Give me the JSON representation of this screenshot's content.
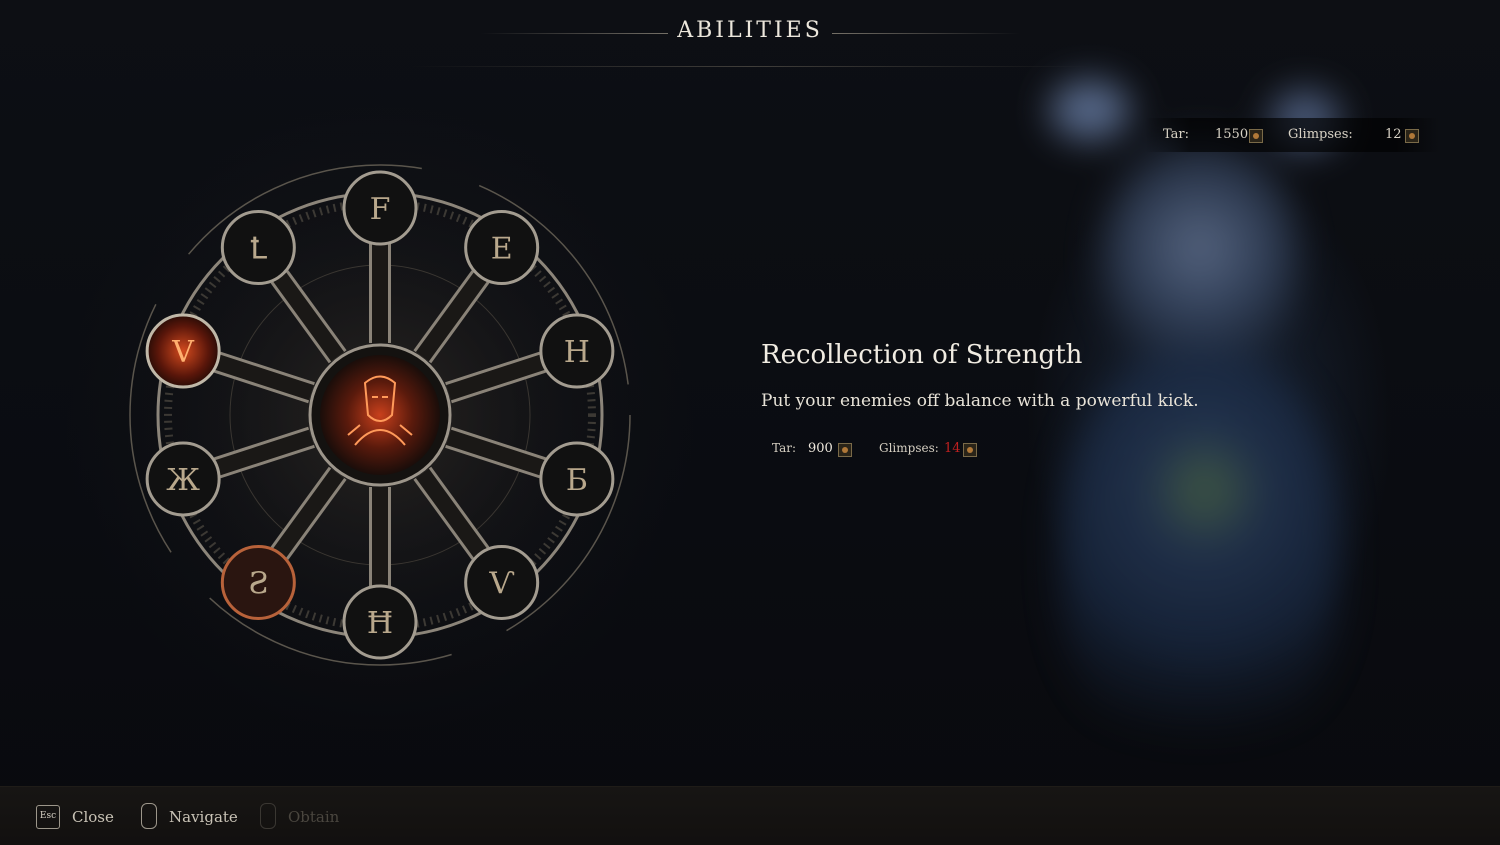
{
  "header": {
    "title": "ABILITIES"
  },
  "resources": {
    "tar_label": "Tar:",
    "tar_value": "1550",
    "glimpses_label": "Glimpses:",
    "glimpses_value": "12"
  },
  "ability": {
    "name": "Recollection of Strength",
    "description": "Put your enemies off balance with a powerful kick.",
    "cost": {
      "tar_label": "Tar:",
      "tar_value": "900",
      "glimpses_label": "Glimpses:",
      "glimpses_value": "14",
      "glimpses_color": "#c02020"
    }
  },
  "wheel": {
    "nodes": [
      {
        "glyph": "F",
        "state": "locked"
      },
      {
        "glyph": "E",
        "state": "locked"
      },
      {
        "glyph": "H",
        "state": "locked"
      },
      {
        "glyph": "Б",
        "state": "locked"
      },
      {
        "glyph": "Ѵ",
        "state": "locked"
      },
      {
        "glyph": "Ħ",
        "state": "locked"
      },
      {
        "glyph": "Ƨ",
        "state": "unlocked"
      },
      {
        "glyph": "Ж",
        "state": "locked"
      },
      {
        "glyph": "V",
        "state": "selected"
      },
      {
        "glyph": "Ꝉ",
        "state": "locked"
      }
    ],
    "center_icon": "kicking-figure-icon",
    "accent_color": "#e0502a"
  },
  "controls": [
    {
      "key": "Esc",
      "label": "Close",
      "enabled": true
    },
    {
      "key": "",
      "label": "Navigate",
      "enabled": true,
      "icon": "mouse-icon"
    },
    {
      "key": "",
      "label": "Obtain",
      "enabled": false,
      "icon": "mouse-left-icon"
    }
  ]
}
